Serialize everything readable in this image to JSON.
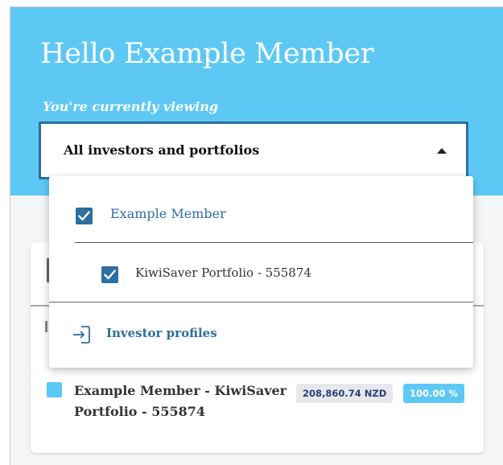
{
  "header": {
    "greeting": "Hello Example Member",
    "viewing_label": "You're currently viewing"
  },
  "selector": {
    "selected_value": "All investors and portfolios",
    "expanded": true
  },
  "dropdown": {
    "options": [
      {
        "label": "Example Member",
        "checked": true
      },
      {
        "label": "KiwiSaver Portfolio - 555874",
        "checked": true
      }
    ],
    "link_label": "Investor profiles"
  },
  "holdings": [
    {
      "name": "Example Member - KiwiSaver Portfolio - 555874",
      "amount": "208,860.74 NZD",
      "percent": "100.00 %",
      "color": "#5ec8f5"
    }
  ],
  "icons": {
    "caret": "caret-up-icon",
    "checkbox": "checkbox-checked-icon",
    "profiles": "login-arrow-icon"
  },
  "colors": {
    "hero": "#5ec8f5",
    "accent": "#2e6ea0",
    "amount_badge_bg": "#e6e8ec",
    "amount_badge_text": "#2a3f7a"
  }
}
